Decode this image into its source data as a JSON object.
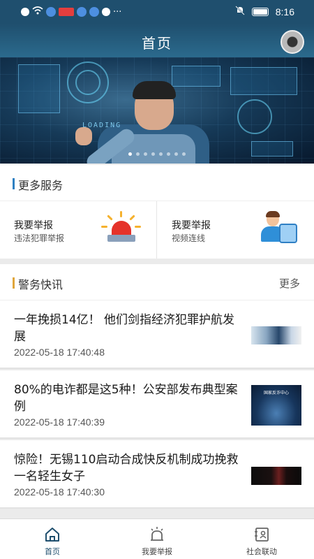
{
  "status_bar": {
    "time": "8:16",
    "left_icons": [
      "alert-icon",
      "wifi-icon",
      "shield-icon",
      "app-badge-icon",
      "cloud-icon",
      "cloud-icon",
      "check-shield-icon",
      "more-dots-icon"
    ],
    "more_glyph": "···",
    "right_icons": [
      "mute-icon",
      "battery-icon"
    ]
  },
  "header": {
    "title": "首页",
    "avatar": "avatar-icon"
  },
  "banner": {
    "overlay_text": "LOADING",
    "slide_count": 8,
    "active_slide": 1
  },
  "services_section": {
    "title": "更多服务",
    "items": [
      {
        "title": "我要举报",
        "subtitle": "违法犯罪举报",
        "icon": "siren-icon"
      },
      {
        "title": "我要举报",
        "subtitle": "视频连线",
        "icon": "video-operator-icon"
      }
    ]
  },
  "news_section": {
    "title": "警务快讯",
    "more_label": "更多",
    "items": [
      {
        "title": "一年挽损14亿！ 他们剑指经济犯罪护航发展",
        "date": "2022-05-18 17:40:48"
      },
      {
        "title": "80%的电诈都是这5种！公安部发布典型案例",
        "date": "2022-05-18 17:40:39",
        "thumb_text": "国家反诈中心"
      },
      {
        "title": "惊险！无锡110启动合成快反机制成功挽救一名轻生女子",
        "date": "2022-05-18 17:40:30"
      }
    ]
  },
  "tab_bar": {
    "tabs": [
      {
        "label": "首页",
        "icon": "home-icon",
        "active": true
      },
      {
        "label": "我要举报",
        "icon": "report-siren-icon",
        "active": false
      },
      {
        "label": "社会联动",
        "icon": "contact-card-icon",
        "active": false
      }
    ],
    "accent_color": "#1f4f6e"
  },
  "colors": {
    "header_bg": "#1f4f6e",
    "section_bar": "#2e80c2",
    "news_bar": "#e0a63c"
  }
}
